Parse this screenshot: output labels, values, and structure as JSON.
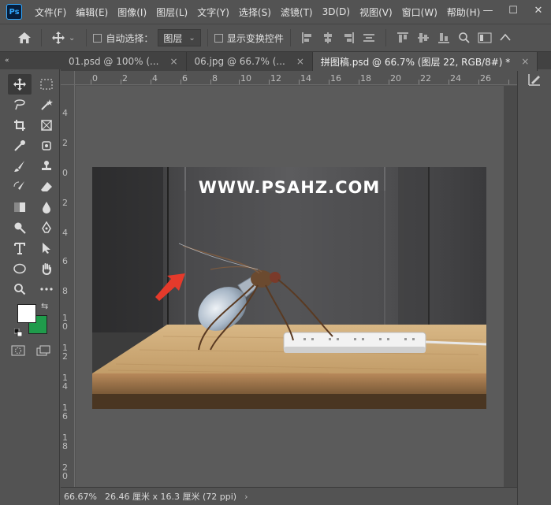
{
  "app": {
    "logo_text": "Ps"
  },
  "menu": [
    "文件(F)",
    "编辑(E)",
    "图像(I)",
    "图层(L)",
    "文字(Y)",
    "选择(S)",
    "滤镜(T)",
    "3D(D)",
    "视图(V)",
    "窗口(W)",
    "帮助(H)"
  ],
  "window_controls": {
    "minimize": "—",
    "maximize": "☐",
    "close": "✕"
  },
  "options": {
    "auto_select_label": "自动选择：",
    "auto_select_value": "图层",
    "show_transform_label": "显示变换控件"
  },
  "tabs": [
    {
      "label": "01.psd @ 100% (...",
      "close": "×"
    },
    {
      "label": "06.jpg @ 66.7% (...",
      "close": "×"
    },
    {
      "label": "拼图稿.psd @ 66.7% (图层 22, RGB/8#) *",
      "close": "×"
    }
  ],
  "rulers": {
    "top": [
      "0",
      "2",
      "4",
      "6",
      "8",
      "10",
      "12",
      "14",
      "16",
      "18",
      "20",
      "22",
      "24",
      "26"
    ],
    "left": [
      "4",
      "2",
      "0",
      "2",
      "4",
      "6",
      "8",
      "1 0",
      "1 2",
      "1 4",
      "1 6",
      "1 8",
      "2 0"
    ]
  },
  "canvas": {
    "watermark": "WWW.PSAHZ.COM"
  },
  "colors": {
    "foreground": "#ffffff",
    "background": "#1f9b4b"
  },
  "status": {
    "zoom": "66.67%",
    "doc_info": "26.46 厘米 x 16.3 厘米 (72 ppi)",
    "arrow": "›"
  },
  "collapse": {
    "left": "«",
    "right": "«"
  }
}
